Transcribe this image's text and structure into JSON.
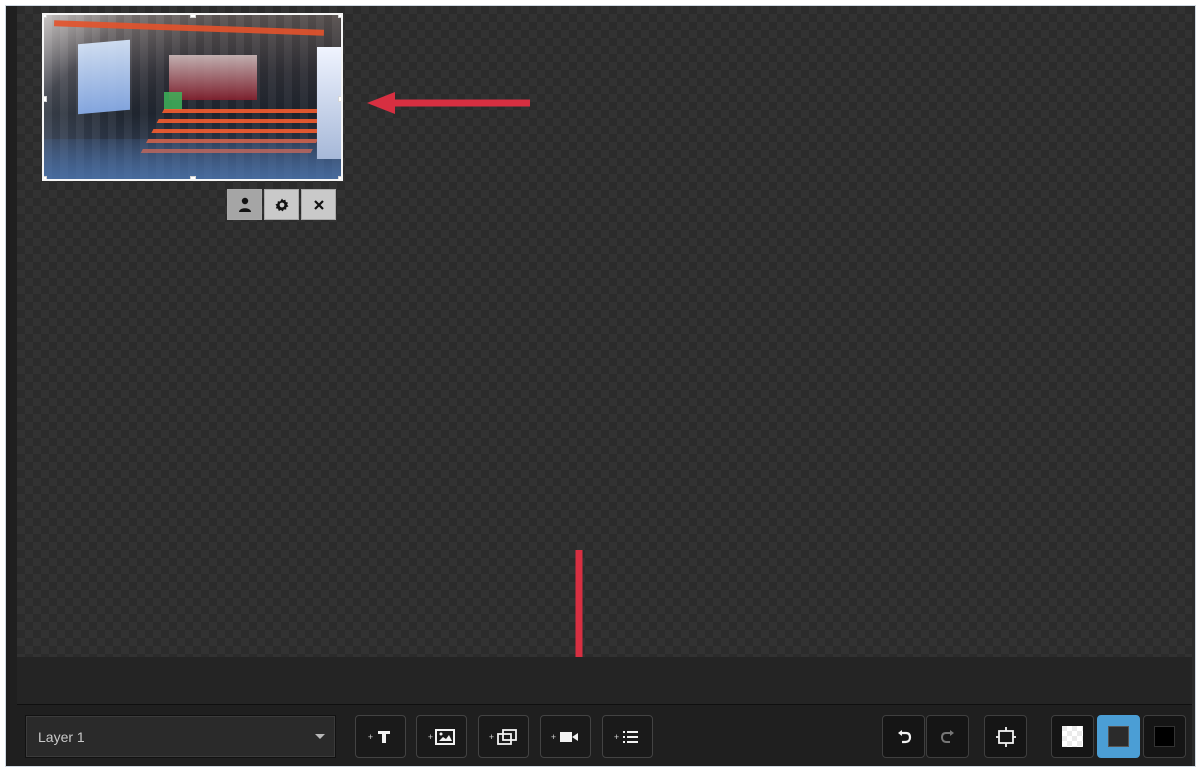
{
  "toolbar": {
    "layer_select": {
      "value": "Layer 1"
    },
    "buttons": [
      {
        "name": "add-text",
        "icon": "text-icon"
      },
      {
        "name": "add-image",
        "icon": "image-icon"
      },
      {
        "name": "add-slideshow",
        "icon": "slideshow-icon"
      },
      {
        "name": "add-video",
        "icon": "video-camera-icon"
      },
      {
        "name": "add-list",
        "icon": "list-icon"
      }
    ],
    "right_buttons": [
      {
        "name": "undo",
        "icon": "undo-icon"
      },
      {
        "name": "redo",
        "icon": "redo-icon"
      },
      {
        "name": "fit-to-screen",
        "icon": "fit-screen-icon"
      },
      {
        "name": "background-transparent",
        "icon": "checker-swatch-icon"
      },
      {
        "name": "background-dark",
        "icon": "dark-swatch-icon"
      },
      {
        "name": "background-black",
        "icon": "black-swatch-icon"
      }
    ]
  },
  "layer_item": {
    "controls": [
      {
        "icon": "person-icon"
      },
      {
        "icon": "gear-icon"
      },
      {
        "icon": "close-icon"
      }
    ]
  },
  "colors": {
    "canvas": "#2b2b2b",
    "toolbar": "#1f1f1f",
    "highlight": "#4b9ed5",
    "annotation": "#d72f41"
  }
}
